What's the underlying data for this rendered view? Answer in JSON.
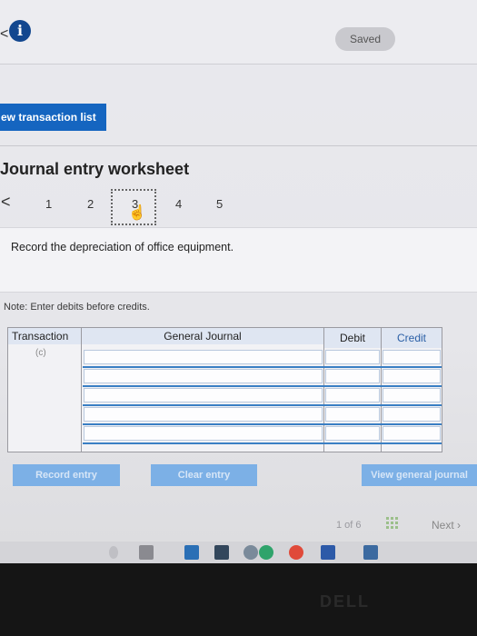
{
  "header": {
    "back_chevron": "<",
    "info_icon": "i",
    "saved_label": "Saved"
  },
  "view_transaction_button": "ew transaction list",
  "worksheet": {
    "title": "Journal entry worksheet",
    "prev_chevron": "<",
    "steps": [
      "1",
      "2",
      "3",
      "4",
      "5"
    ],
    "active_step": "3",
    "instruction": "Record the depreciation of office equipment.",
    "note": "Note: Enter debits before credits."
  },
  "journal": {
    "headers": {
      "transaction": "Transaction",
      "general_journal": "General Journal",
      "debit": "Debit",
      "credit": "Credit"
    },
    "transaction_label": "(c)",
    "rows": 6
  },
  "actions": {
    "record_entry": "Record entry",
    "clear_entry": "Clear entry",
    "view_general_journal": "View general journal"
  },
  "pager": {
    "position": "1 of 6",
    "next_label": "Next"
  },
  "colors": {
    "accent": "#1565c0",
    "button_disabled": "#7cb0e6",
    "row_line": "#3a7fc4"
  },
  "icons": [
    "info-icon",
    "hand-cursor-icon",
    "grid-icon",
    "next-chevron-icon",
    "taskbar-app-icons"
  ],
  "bezel_brand": "DELL"
}
